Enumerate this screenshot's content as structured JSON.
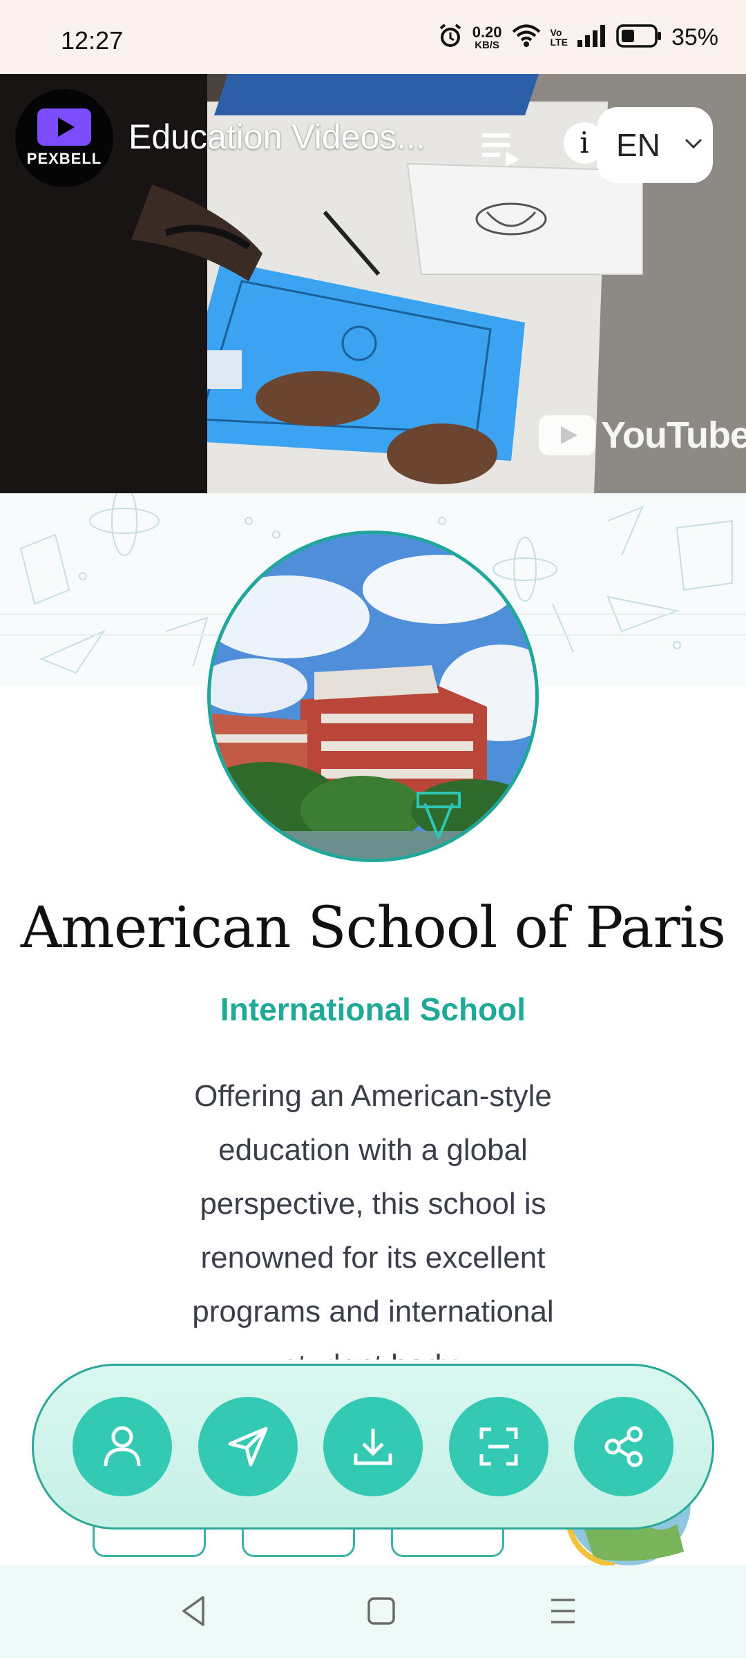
{
  "status_bar": {
    "time": "12:27",
    "net_speed_value": "0.20",
    "net_speed_unit": "KB/S",
    "volte_top": "Vo",
    "volte_bottom": "LTE",
    "battery_percent": "35%"
  },
  "video": {
    "channel_name": "PEXBELL",
    "title": "Education Videos...",
    "language": "EN",
    "watermark": "YouTube"
  },
  "profile": {
    "name": "American School of Paris",
    "type": "International School",
    "description": "Offering an American-style education with a global perspective, this school is renowned for its excellent programs and international student body."
  },
  "actions": [
    {
      "name": "contact",
      "icon": "person-icon"
    },
    {
      "name": "send",
      "icon": "send-icon"
    },
    {
      "name": "download",
      "icon": "download-icon"
    },
    {
      "name": "scan",
      "icon": "scan-icon"
    },
    {
      "name": "share",
      "icon": "share-icon"
    }
  ],
  "colors": {
    "accent": "#34c9b2",
    "subtitle": "#21a997",
    "status_bg": "#fbf1ee"
  }
}
